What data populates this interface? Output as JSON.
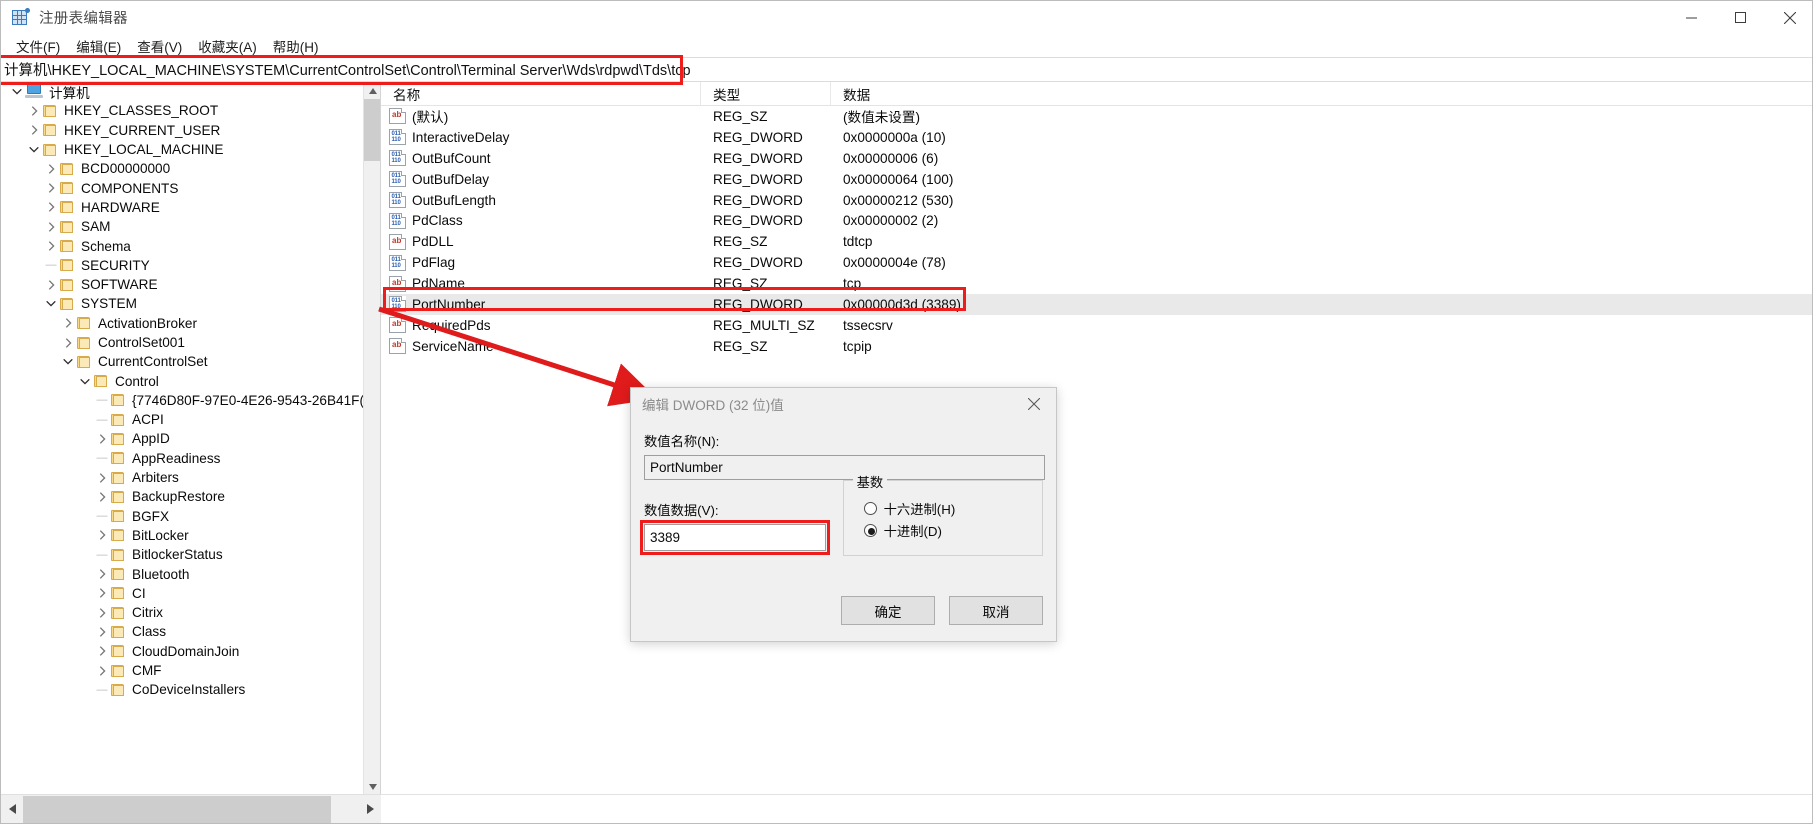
{
  "window": {
    "title": "注册表编辑器",
    "icon": "registry-icon",
    "minimize": "minimize-icon",
    "maximize": "maximize-icon",
    "close": "close-icon"
  },
  "menubar": {
    "items": [
      {
        "label": "文件(F)"
      },
      {
        "label": "编辑(E)"
      },
      {
        "label": "查看(V)"
      },
      {
        "label": "收藏夹(A)"
      },
      {
        "label": "帮助(H)"
      }
    ]
  },
  "address": {
    "value": "计算机\\HKEY_LOCAL_MACHINE\\SYSTEM\\CurrentControlSet\\Control\\Terminal Server\\Wds\\rdpwd\\Tds\\tcp",
    "highlight_color": "#ef1c1c"
  },
  "tree": {
    "nodes": [
      {
        "label": "计算机",
        "depth": 0,
        "state": "expanded",
        "icon": "computer-icon"
      },
      {
        "label": "HKEY_CLASSES_ROOT",
        "depth": 1,
        "state": "collapsed",
        "icon": "folder-icon"
      },
      {
        "label": "HKEY_CURRENT_USER",
        "depth": 1,
        "state": "collapsed",
        "icon": "folder-icon"
      },
      {
        "label": "HKEY_LOCAL_MACHINE",
        "depth": 1,
        "state": "expanded",
        "icon": "folder-icon"
      },
      {
        "label": "BCD00000000",
        "depth": 2,
        "state": "collapsed",
        "icon": "folder-icon"
      },
      {
        "label": "COMPONENTS",
        "depth": 2,
        "state": "collapsed",
        "icon": "folder-icon"
      },
      {
        "label": "HARDWARE",
        "depth": 2,
        "state": "collapsed",
        "icon": "folder-icon"
      },
      {
        "label": "SAM",
        "depth": 2,
        "state": "collapsed",
        "icon": "folder-icon"
      },
      {
        "label": "Schema",
        "depth": 2,
        "state": "collapsed",
        "icon": "folder-icon"
      },
      {
        "label": "SECURITY",
        "depth": 2,
        "state": "leaf",
        "icon": "folder-icon"
      },
      {
        "label": "SOFTWARE",
        "depth": 2,
        "state": "collapsed",
        "icon": "folder-icon"
      },
      {
        "label": "SYSTEM",
        "depth": 2,
        "state": "expanded",
        "icon": "folder-icon"
      },
      {
        "label": "ActivationBroker",
        "depth": 3,
        "state": "collapsed",
        "icon": "folder-icon"
      },
      {
        "label": "ControlSet001",
        "depth": 3,
        "state": "collapsed",
        "icon": "folder-icon"
      },
      {
        "label": "CurrentControlSet",
        "depth": 3,
        "state": "expanded",
        "icon": "folder-icon"
      },
      {
        "label": "Control",
        "depth": 4,
        "state": "expanded",
        "icon": "folder-icon"
      },
      {
        "label": "{7746D80F-97E0-4E26-9543-26B41F(",
        "depth": 5,
        "state": "leaf",
        "icon": "folder-icon"
      },
      {
        "label": "ACPI",
        "depth": 5,
        "state": "leaf",
        "icon": "folder-icon"
      },
      {
        "label": "AppID",
        "depth": 5,
        "state": "collapsed",
        "icon": "folder-icon"
      },
      {
        "label": "AppReadiness",
        "depth": 5,
        "state": "leaf",
        "icon": "folder-icon"
      },
      {
        "label": "Arbiters",
        "depth": 5,
        "state": "collapsed",
        "icon": "folder-icon"
      },
      {
        "label": "BackupRestore",
        "depth": 5,
        "state": "collapsed",
        "icon": "folder-icon"
      },
      {
        "label": "BGFX",
        "depth": 5,
        "state": "leaf",
        "icon": "folder-icon"
      },
      {
        "label": "BitLocker",
        "depth": 5,
        "state": "collapsed",
        "icon": "folder-icon"
      },
      {
        "label": "BitlockerStatus",
        "depth": 5,
        "state": "leaf",
        "icon": "folder-icon"
      },
      {
        "label": "Bluetooth",
        "depth": 5,
        "state": "collapsed",
        "icon": "folder-icon"
      },
      {
        "label": "CI",
        "depth": 5,
        "state": "collapsed",
        "icon": "folder-icon"
      },
      {
        "label": "Citrix",
        "depth": 5,
        "state": "collapsed",
        "icon": "folder-icon"
      },
      {
        "label": "Class",
        "depth": 5,
        "state": "collapsed",
        "icon": "folder-icon"
      },
      {
        "label": "CloudDomainJoin",
        "depth": 5,
        "state": "collapsed",
        "icon": "folder-icon"
      },
      {
        "label": "CMF",
        "depth": 5,
        "state": "collapsed",
        "icon": "folder-icon"
      },
      {
        "label": "CoDeviceInstallers",
        "depth": 5,
        "state": "leaf",
        "icon": "folder-icon"
      }
    ]
  },
  "list": {
    "headers": {
      "name": "名称",
      "type": "类型",
      "data": "数据"
    },
    "rows": [
      {
        "name": "(默认)",
        "type": "REG_SZ",
        "data": "(数值未设置)",
        "icon": "string-value-icon",
        "selected": false
      },
      {
        "name": "InteractiveDelay",
        "type": "REG_DWORD",
        "data": "0x0000000a (10)",
        "icon": "dword-value-icon",
        "selected": false
      },
      {
        "name": "OutBufCount",
        "type": "REG_DWORD",
        "data": "0x00000006 (6)",
        "icon": "dword-value-icon",
        "selected": false
      },
      {
        "name": "OutBufDelay",
        "type": "REG_DWORD",
        "data": "0x00000064 (100)",
        "icon": "dword-value-icon",
        "selected": false
      },
      {
        "name": "OutBufLength",
        "type": "REG_DWORD",
        "data": "0x00000212 (530)",
        "icon": "dword-value-icon",
        "selected": false
      },
      {
        "name": "PdClass",
        "type": "REG_DWORD",
        "data": "0x00000002 (2)",
        "icon": "dword-value-icon",
        "selected": false
      },
      {
        "name": "PdDLL",
        "type": "REG_SZ",
        "data": "tdtcp",
        "icon": "string-value-icon",
        "selected": false
      },
      {
        "name": "PdFlag",
        "type": "REG_DWORD",
        "data": "0x0000004e (78)",
        "icon": "dword-value-icon",
        "selected": false
      },
      {
        "name": "PdName",
        "type": "REG_SZ",
        "data": "tcp",
        "icon": "string-value-icon",
        "selected": false
      },
      {
        "name": "PortNumber",
        "type": "REG_DWORD",
        "data": "0x00000d3d (3389)",
        "icon": "dword-value-icon",
        "selected": true
      },
      {
        "name": "RequiredPds",
        "type": "REG_MULTI_SZ",
        "data": "tssecsrv",
        "icon": "string-value-icon",
        "selected": false
      },
      {
        "name": "ServiceName",
        "type": "REG_SZ",
        "data": "tcpip",
        "icon": "string-value-icon",
        "selected": false
      }
    ]
  },
  "dialog": {
    "title": "编辑 DWORD (32 位)值",
    "close_icon": "close-icon",
    "name_label": "数值名称(N):",
    "name_value": "PortNumber",
    "data_label": "数值数据(V):",
    "data_value": "3389",
    "base_legend": "基数",
    "radio_hex": "十六进制(H)",
    "radio_dec": "十进制(D)",
    "radio_selected": "十进制(D)",
    "ok_label": "确定",
    "cancel_label": "取消"
  },
  "annotations": {
    "arrow_color": "#e01b1b",
    "box_color": "#ef1c1c"
  }
}
